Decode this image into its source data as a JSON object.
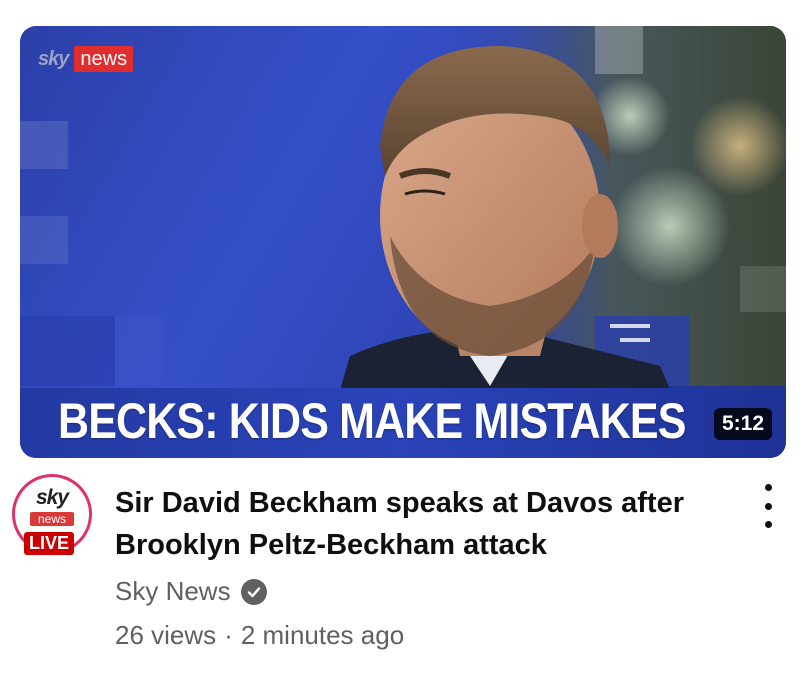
{
  "thumbnail": {
    "brand_sky": "sky",
    "brand_news": "news",
    "headline": "BECKS: KIDS MAKE MISTAKES",
    "duration": "5:12"
  },
  "channel_avatar": {
    "sky": "sky",
    "news": "news",
    "live_label": "LIVE"
  },
  "video": {
    "title": "Sir David Beckham speaks at Davos after Brooklyn Peltz-Beckham attack",
    "channel_name": "Sky News",
    "views": "26 views",
    "separator": "·",
    "age": "2 minutes ago",
    "verified_icon": "verified-check-icon"
  },
  "colors": {
    "title_text": "#0f0f0f",
    "meta_text": "#606060",
    "live_red": "#cc0000",
    "sky_news_red": "#e02d2d"
  }
}
